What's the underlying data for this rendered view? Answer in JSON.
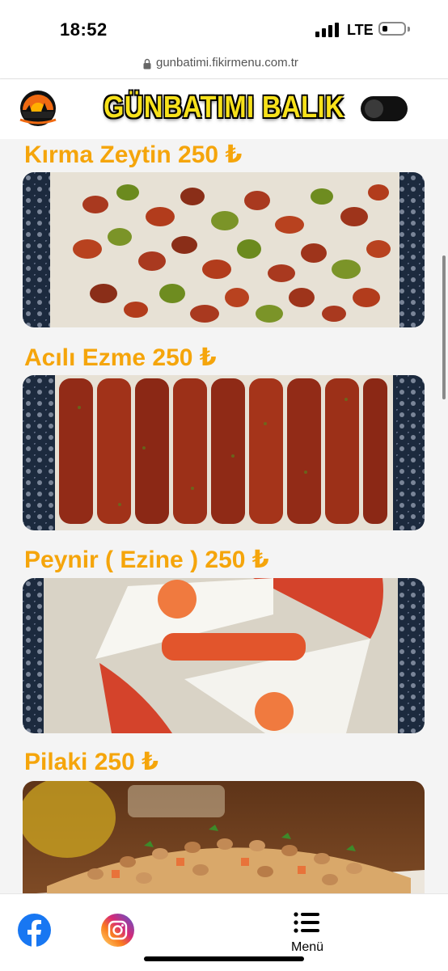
{
  "status_bar": {
    "time": "18:52",
    "network": "LTE"
  },
  "browser": {
    "url": "gunbatimi.fikirmenu.com.tr"
  },
  "header": {
    "brand": "GÜNBATIMI BALIK",
    "logo_icon": "restaurant-logo-sunset-icon",
    "theme_toggle": "dark-mode-toggle"
  },
  "menu_items": [
    {
      "title": "Kırma Zeytin 250 ₺"
    },
    {
      "title": "Acılı Ezme 250 ₺"
    },
    {
      "title": "Peynir ( Ezine ) 250 ₺"
    },
    {
      "title": "Pilaki 250 ₺"
    }
  ],
  "bottom_nav": {
    "facebook_icon": "facebook-icon",
    "instagram_icon": "instagram-icon",
    "menu_label": "Menü"
  },
  "colors": {
    "accent": "#f5a50b",
    "brand_yellow": "#f7e11b",
    "background": "#f4f4f4"
  }
}
